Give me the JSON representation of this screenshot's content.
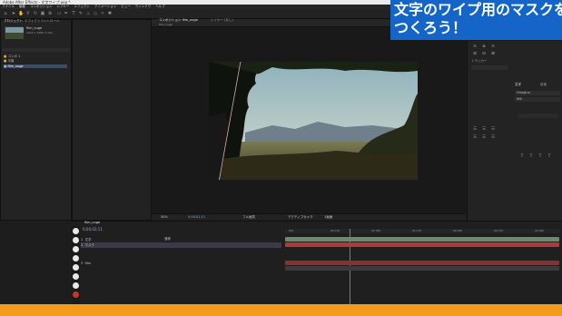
{
  "window": {
    "title": "Adobe After Effects - 文字ワイプ.aep *"
  },
  "menu": [
    "ファイル",
    "編集",
    "コンポジション",
    "レイヤー",
    "エフェクト",
    "アニメーション",
    "ビュー",
    "ウィンドウ",
    "ヘルプ"
  ],
  "toolbar": {
    "icons": [
      "home-icon",
      "selection-icon",
      "hand-icon",
      "zoom-icon",
      "rotate-icon",
      "camera-icon",
      "pan-icon",
      "rect-icon",
      "pen-icon",
      "text-icon",
      "brush-icon",
      "stamp-icon",
      "eraser-icon",
      "roto-icon",
      "puppet-icon"
    ]
  },
  "project": {
    "tab": "プロジェクト",
    "effect_tab": "エフェクトコントロール",
    "item_name": "film_nuge",
    "item_info": "1920 x 1080 (1.00)",
    "rows": [
      "コンポ 1",
      "平面",
      "film_nuge"
    ]
  },
  "composition": {
    "tab": "コンポジション film_nuge",
    "layer_tab": "レイヤー (なし)",
    "breadcrumb": "film_nuge",
    "zoom": "50%",
    "timecode": "0;00;02;11",
    "quality": "フル画質",
    "camera": "アクティブカメラ",
    "view": "1画面"
  },
  "timeline": {
    "tab": "film_nuge",
    "timecode": "0;00;02;11",
    "layers": [
      {
        "num": "1",
        "name": "文字"
      },
      {
        "num": "2",
        "name": "マスク"
      },
      {
        "num": "3",
        "name": "film"
      }
    ],
    "mode_label": "通常",
    "ruler": [
      "00f",
      "00:15f",
      "01:00f",
      "01:15f",
      "02:00f",
      "02:15f",
      "03:00f"
    ]
  },
  "right_panel": {
    "paragraph_tab": "段落",
    "character_tab": "文字",
    "tracker": "トラッカー",
    "font": "Hiragino",
    "style": "W6"
  },
  "overlay": {
    "line1": "文字のワイプ用のマスクを",
    "line2": "つくろう！"
  },
  "colors": {
    "overlay": "#1564c8",
    "stripe": "#f39c1c",
    "track_red": "#b03a3a",
    "track_green": "#4a7a4a"
  }
}
